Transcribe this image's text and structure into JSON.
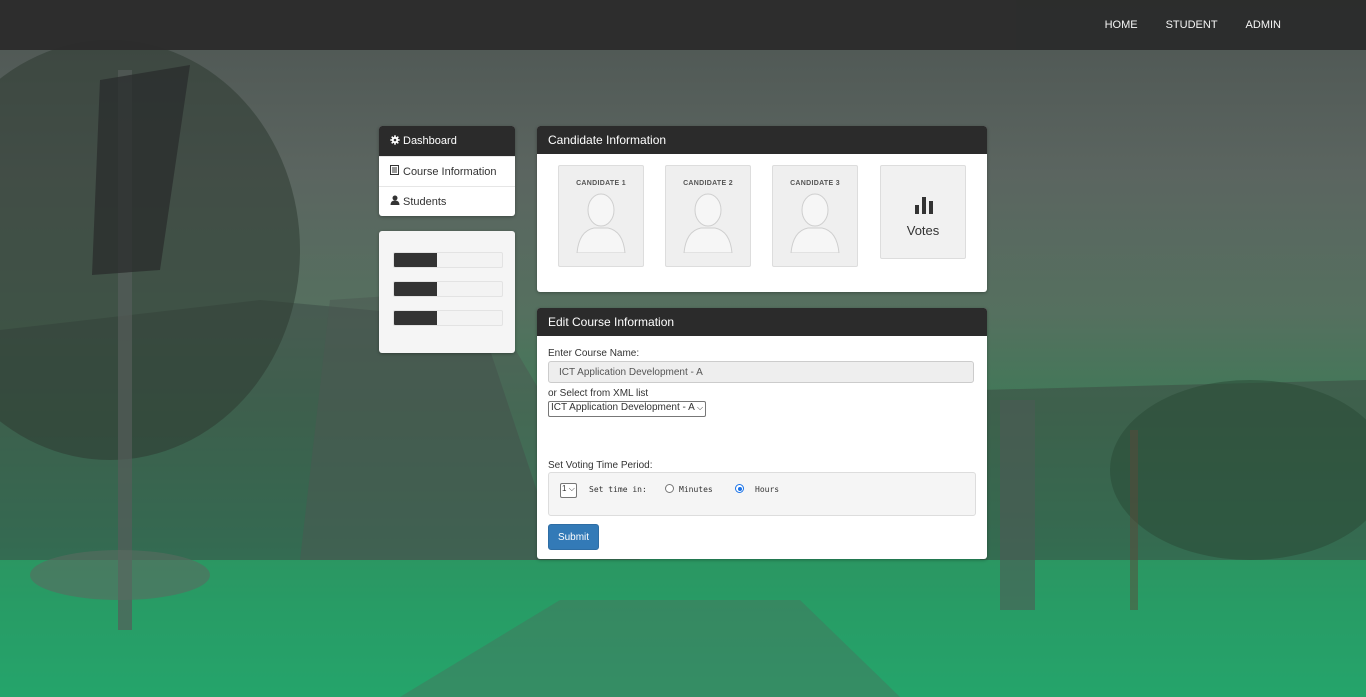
{
  "nav": {
    "home": "HOME",
    "student": "STUDENT",
    "admin": "ADMIN"
  },
  "sidebar": {
    "items": [
      {
        "label": "Dashboard",
        "icon": "gear-icon"
      },
      {
        "label": "Course Information",
        "icon": "list-icon"
      },
      {
        "label": "Students",
        "icon": "user-icon"
      }
    ]
  },
  "progress_bars": [
    {
      "value": 0.4
    },
    {
      "value": 0.4
    },
    {
      "value": 0.4
    }
  ],
  "candidates_panel": {
    "title": "Candidate Information",
    "candidates": [
      {
        "label": "CANDIDATE 1"
      },
      {
        "label": "CANDIDATE 2"
      },
      {
        "label": "CANDIDATE 3"
      }
    ],
    "votes": {
      "label": "Votes",
      "icon": "bar-chart-icon"
    }
  },
  "course_panel": {
    "title": "Edit Course Information",
    "course_name_label": "Enter Course Name:",
    "course_name_value": "ICT Application Development - A",
    "xml_label": "or Select from XML list",
    "xml_selected": "ICT Application Development - A",
    "time_label": "Set Voting Time Period:",
    "time_value": "1",
    "set_time_in": "Set time in:",
    "unit_minutes": "Minutes",
    "unit_hours": "Hours",
    "selected_unit": "Hours",
    "submit_label": "Submit"
  },
  "colors": {
    "navbar": "#2b2b2b",
    "accent": "#337ab7",
    "radio": "#1a73e8"
  }
}
